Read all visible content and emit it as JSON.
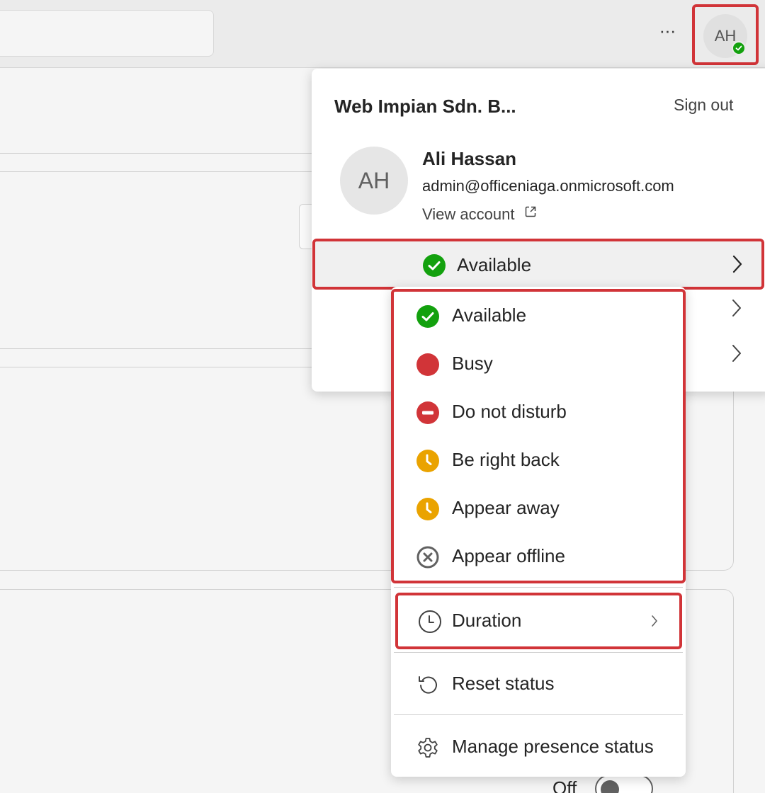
{
  "topbar": {
    "more_label": "···",
    "avatar_initials": "AH",
    "avatar_status_color": "#13a10e"
  },
  "account": {
    "org_name": "Web Impian Sdn. B...",
    "sign_out_label": "Sign out",
    "avatar_initials": "AH",
    "user_name": "Ali Hassan",
    "email": "admin@officeniaga.onmicrosoft.com",
    "view_account_label": "View account",
    "current_status": "Available"
  },
  "status_menu": {
    "options": [
      {
        "label": "Available",
        "icon": "available-icon",
        "color": "#13a10e"
      },
      {
        "label": "Busy",
        "icon": "busy-icon",
        "color": "#d13438"
      },
      {
        "label": "Do not disturb",
        "icon": "do-not-disturb-icon",
        "color": "#d13438"
      },
      {
        "label": "Be right back",
        "icon": "clock-away-icon",
        "color": "#eaa300"
      },
      {
        "label": "Appear away",
        "icon": "clock-away-icon",
        "color": "#eaa300"
      },
      {
        "label": "Appear offline",
        "icon": "offline-icon",
        "color": "#616161"
      }
    ],
    "duration_label": "Duration",
    "reset_label": "Reset status",
    "manage_label": "Manage presence status"
  },
  "background": {
    "toggle_label": "Off"
  }
}
